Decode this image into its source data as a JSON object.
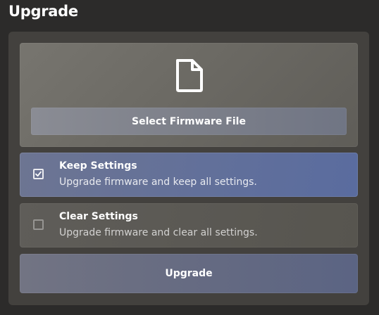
{
  "page": {
    "title": "Upgrade"
  },
  "file_select": {
    "icon": "file-icon",
    "button_label": "Select Firmware File"
  },
  "options": [
    {
      "title": "Keep Settings",
      "description": "Upgrade firmware and keep all settings.",
      "checked": true
    },
    {
      "title": "Clear Settings",
      "description": "Upgrade firmware and clear all settings.",
      "checked": false
    }
  ],
  "actions": {
    "upgrade_label": "Upgrade"
  },
  "colors": {
    "background": "#2c2b2a",
    "panel": "#43413e",
    "selected_option": "#62709a",
    "button": "#7d808a"
  }
}
